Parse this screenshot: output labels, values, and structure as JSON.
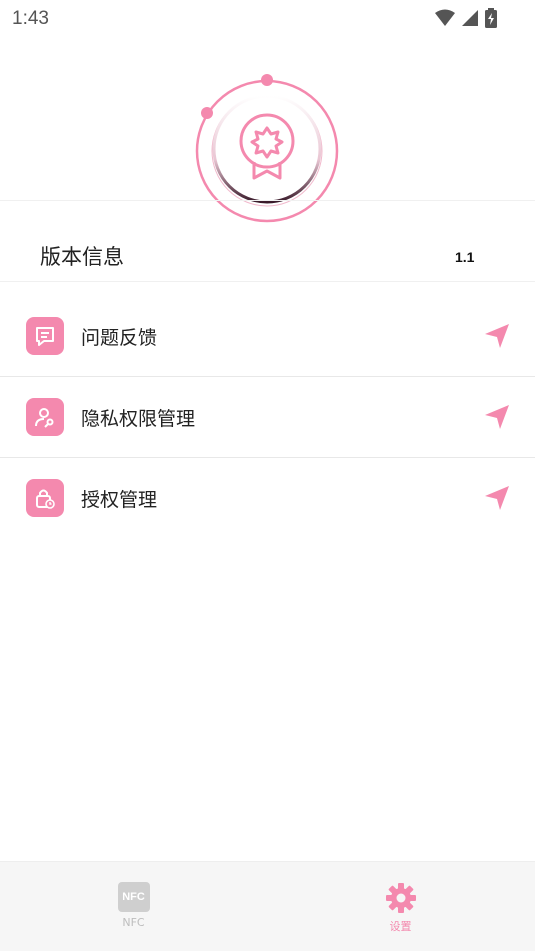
{
  "status_bar": {
    "time": "1:43"
  },
  "version": {
    "label": "版本信息",
    "value": "1.1"
  },
  "menu": [
    {
      "label": "问题反馈",
      "icon": "feedback-icon"
    },
    {
      "label": "隐私权限管理",
      "icon": "privacy-icon"
    },
    {
      "label": "授权管理",
      "icon": "lock-icon"
    }
  ],
  "bottom_nav": {
    "tabs": [
      {
        "label": "NFC",
        "icon": "nfc-icon",
        "badge_text": "NFC",
        "active": false
      },
      {
        "label": "设置",
        "icon": "gear-icon",
        "active": true
      }
    ]
  },
  "colors": {
    "accent": "#f489ae",
    "inactive": "#cfcfcf"
  }
}
